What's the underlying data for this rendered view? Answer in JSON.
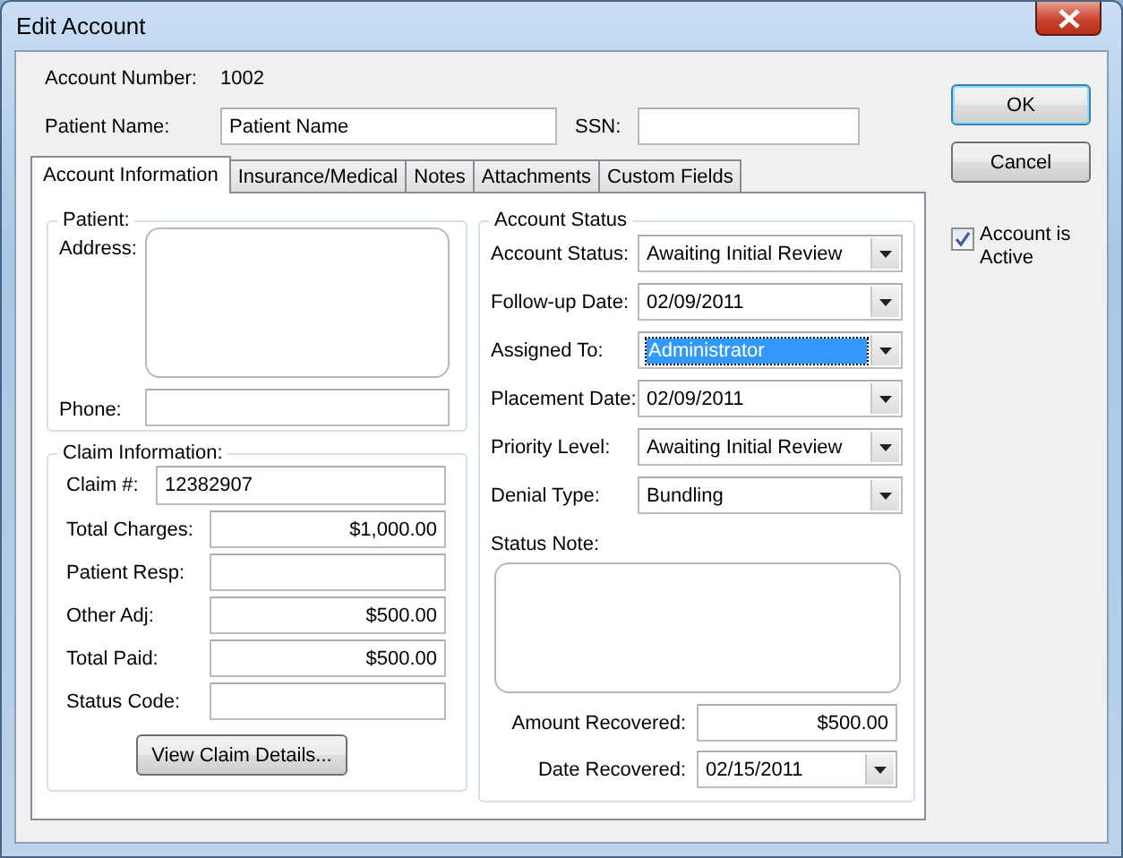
{
  "window": {
    "title": "Edit Account"
  },
  "account_number": {
    "label": "Account Number:",
    "value": "1002"
  },
  "patient_name": {
    "label": "Patient Name:",
    "value": "Patient Name"
  },
  "ssn": {
    "label": "SSN:"
  },
  "tabs": [
    {
      "label": "Account Information",
      "selected": true
    },
    {
      "label": "Insurance/Medical",
      "selected": false
    },
    {
      "label": "Notes",
      "selected": false
    },
    {
      "label": "Attachments",
      "selected": false
    },
    {
      "label": "Custom Fields",
      "selected": false
    }
  ],
  "patient_group": {
    "title": "Patient:",
    "address_label": "Address:",
    "phone_label": "Phone:"
  },
  "claim_group": {
    "title": "Claim Information:",
    "fields": [
      {
        "label": "Claim #:",
        "value": "12382907",
        "kind": "text"
      },
      {
        "label": "Total Charges:",
        "value": "$1,000.00",
        "kind": "amount"
      },
      {
        "label": "Patient Resp:",
        "kind": "amount"
      },
      {
        "label": "Other Adj:",
        "value": "$500.00",
        "kind": "amount"
      },
      {
        "label": "Total Paid:",
        "value": "$500.00",
        "kind": "amount"
      },
      {
        "label": "Status Code:",
        "kind": "text"
      }
    ],
    "button": "View Claim Details..."
  },
  "status_group": {
    "title": "Account Status",
    "fields": [
      {
        "label": "Account Status:",
        "value": "Awaiting Initial Review",
        "focused": false
      },
      {
        "label": "Follow-up Date:",
        "value": "02/09/2011",
        "focused": false
      },
      {
        "label": "Assigned To:",
        "value": "Administrator",
        "focused": true
      },
      {
        "label": "Placement Date:",
        "value": "02/09/2011",
        "focused": false
      },
      {
        "label": "Priority Level:",
        "value": "Awaiting Initial Review",
        "focused": false
      },
      {
        "label": "Denial Type:",
        "value": "Bundling",
        "focused": false
      }
    ],
    "note_label": "Status Note:",
    "recovered": [
      {
        "label": "Amount Recovered:",
        "value": "$500.00",
        "kind": "amount"
      },
      {
        "label": "Date Recovered:",
        "value": "02/15/2011",
        "kind": "dropdown"
      }
    ]
  },
  "buttons": [
    {
      "label": "OK",
      "default": true
    },
    {
      "label": "Cancel",
      "default": false
    }
  ],
  "active_checkbox": {
    "label": "Account is Active",
    "checked": true
  }
}
